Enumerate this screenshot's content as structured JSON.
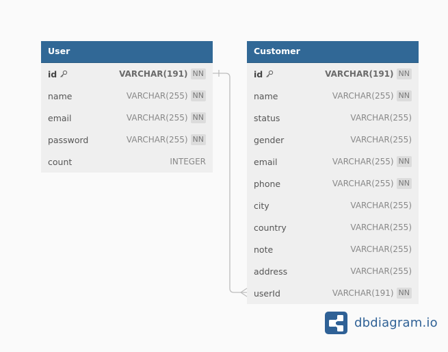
{
  "tables": [
    {
      "name": "User",
      "columns": [
        {
          "name": "id",
          "type": "VARCHAR(191)",
          "pk": true,
          "nn": "NN"
        },
        {
          "name": "name",
          "type": "VARCHAR(255)",
          "pk": false,
          "nn": "NN"
        },
        {
          "name": "email",
          "type": "VARCHAR(255)",
          "pk": false,
          "nn": "NN"
        },
        {
          "name": "password",
          "type": "VARCHAR(255)",
          "pk": false,
          "nn": "NN"
        },
        {
          "name": "count",
          "type": "INTEGER",
          "pk": false,
          "nn": ""
        }
      ]
    },
    {
      "name": "Customer",
      "columns": [
        {
          "name": "id",
          "type": "VARCHAR(191)",
          "pk": true,
          "nn": "NN"
        },
        {
          "name": "name",
          "type": "VARCHAR(255)",
          "pk": false,
          "nn": "NN"
        },
        {
          "name": "status",
          "type": "VARCHAR(255)",
          "pk": false,
          "nn": ""
        },
        {
          "name": "gender",
          "type": "VARCHAR(255)",
          "pk": false,
          "nn": ""
        },
        {
          "name": "email",
          "type": "VARCHAR(255)",
          "pk": false,
          "nn": "NN"
        },
        {
          "name": "phone",
          "type": "VARCHAR(255)",
          "pk": false,
          "nn": "NN"
        },
        {
          "name": "city",
          "type": "VARCHAR(255)",
          "pk": false,
          "nn": ""
        },
        {
          "name": "country",
          "type": "VARCHAR(255)",
          "pk": false,
          "nn": ""
        },
        {
          "name": "note",
          "type": "VARCHAR(255)",
          "pk": false,
          "nn": ""
        },
        {
          "name": "address",
          "type": "VARCHAR(255)",
          "pk": false,
          "nn": ""
        },
        {
          "name": "userId",
          "type": "VARCHAR(191)",
          "pk": false,
          "nn": "NN"
        }
      ]
    }
  ],
  "relationship": {
    "from": "User.id",
    "to": "Customer.userId",
    "type": "one-to-many"
  },
  "brand": {
    "text": "dbdiagram.io",
    "icon": "dbdiagram-logo-icon"
  },
  "colors": {
    "header": "#316896",
    "brand": "#2f6196"
  }
}
